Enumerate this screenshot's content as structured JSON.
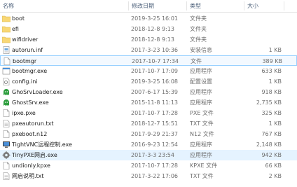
{
  "columns": {
    "name": "名称",
    "date": "修改日期",
    "type": "类型",
    "size": "大小"
  },
  "rows": [
    {
      "name": "boot",
      "date": "2019-3-25 16:01",
      "type": "文件夹",
      "size": "",
      "icon": "folder-icon"
    },
    {
      "name": "efi",
      "date": "2018-12-8 9:13",
      "type": "文件夹",
      "size": "",
      "icon": "folder-icon"
    },
    {
      "name": "wifidriver",
      "date": "2018-12-8 9:13",
      "type": "文件夹",
      "size": "",
      "icon": "folder-icon"
    },
    {
      "name": "autorun.inf",
      "date": "2017-3-23 10:36",
      "type": "安装信息",
      "size": "1 KB",
      "icon": "setup-info-icon"
    },
    {
      "name": "bootmgr",
      "date": "2017-10-7 17:34",
      "type": "文件",
      "size": "389 KB",
      "icon": "file-icon"
    },
    {
      "name": "bootmgr.exe",
      "date": "2017-10-7 17:09",
      "type": "应用程序",
      "size": "633 KB",
      "icon": "app-icon"
    },
    {
      "name": "config.ini",
      "date": "2019-3-25 16:08",
      "type": "配置设置",
      "size": "1 KB",
      "icon": "config-icon"
    },
    {
      "name": "GhoSrvLoader.exe",
      "date": "2007-6-17 15:39",
      "type": "应用程序",
      "size": "918 KB",
      "icon": "ghost-icon"
    },
    {
      "name": "GhostSrv.exe",
      "date": "2015-11-8 11:13",
      "type": "应用程序",
      "size": "2,735 KB",
      "icon": "ghost-icon"
    },
    {
      "name": "ipxe.pxe",
      "date": "2017-10-7 17:28",
      "type": "PXE 文件",
      "size": "325 KB",
      "icon": "file-icon"
    },
    {
      "name": "pxeautorun.txt",
      "date": "2018-12-7 15:51",
      "type": "TXT 文件",
      "size": "1 KB",
      "icon": "text-icon"
    },
    {
      "name": "pxeboot.n12",
      "date": "2017-9-29 21:37",
      "type": "N12 文件",
      "size": "767 KB",
      "icon": "file-icon"
    },
    {
      "name": "TightVNC远程控制.exe",
      "date": "2016-9-23 12:54",
      "type": "应用程序",
      "size": "2,148 KB",
      "icon": "vnc-icon"
    },
    {
      "name": "TinyPXE网启.exe",
      "date": "2017-3-3 23:54",
      "type": "应用程序",
      "size": "942 KB",
      "icon": "gear-icon"
    },
    {
      "name": "undionly.kpxe",
      "date": "2017-10-7 17:28",
      "type": "KPXE 文件",
      "size": "66 KB",
      "icon": "file-icon"
    },
    {
      "name": "网启说明.txt",
      "date": "2017-3-22 17:06",
      "type": "TXT 文件",
      "size": "2 KB",
      "icon": "text-icon"
    }
  ],
  "colors": {
    "header_text": "#4c607a",
    "hover_row": "#e5f3ff",
    "selected_border": "#99d1ff",
    "folder": "#f8d775",
    "ghost": "#2e9e3e"
  }
}
